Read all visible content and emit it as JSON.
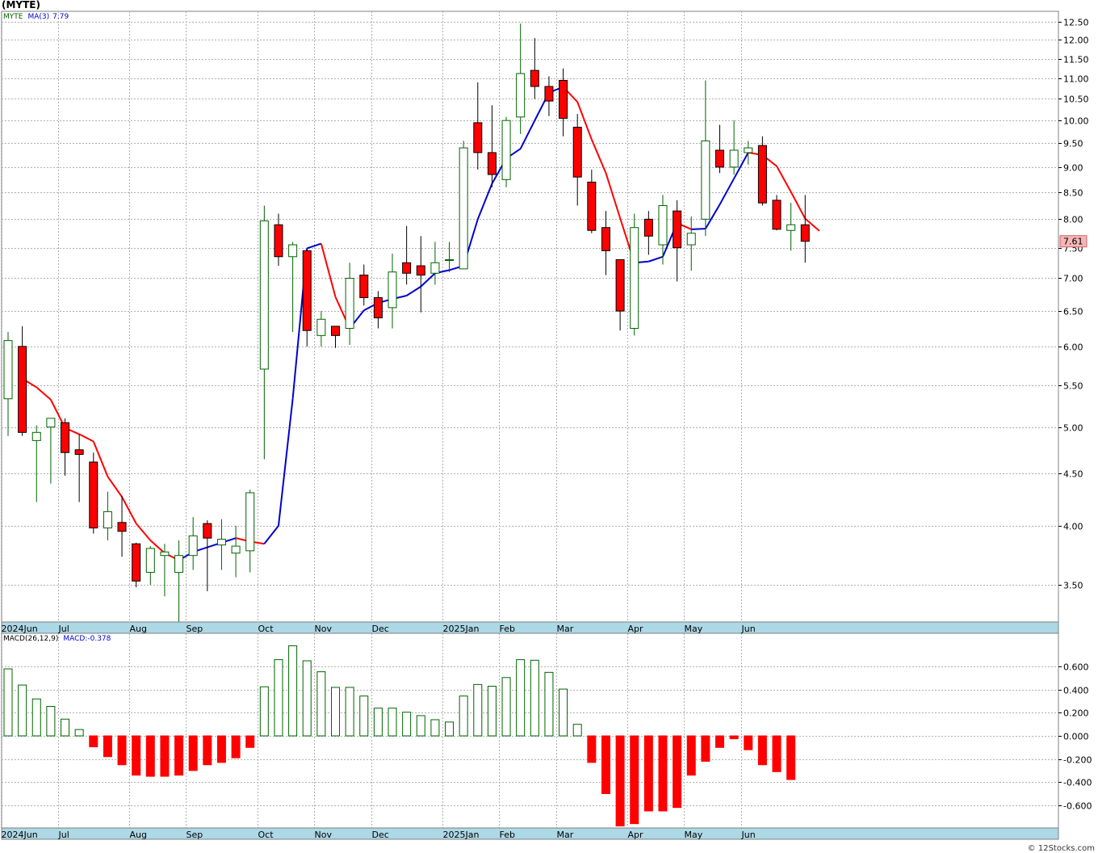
{
  "header": {
    "title": "(MYTE)"
  },
  "legend_price": {
    "symbol": "MYTE",
    "ma_label": "MA(3)",
    "ma_value": "7.79"
  },
  "legend_macd": {
    "label": "MACD(26,12,9)",
    "value": "MACD:-0.378"
  },
  "credit": "© 12Stocks.com",
  "colors": {
    "up": "#006400",
    "down": "#ff0000",
    "ma_up": "#0000cc",
    "ma_down": "#ff0000",
    "axis_band": "#add8e6",
    "grid": "#b0b0b0",
    "last_price_box": "#f4b6b6"
  },
  "chart_data": [
    {
      "type": "candlestick",
      "title": "(MYTE)",
      "scale": "log",
      "ylim": [
        3.2,
        12.8
      ],
      "y_ticks": [
        "12.50",
        "12.00",
        "11.50",
        "11.00",
        "10.50",
        "10.00",
        "9.50",
        "9.00",
        "8.50",
        "8.00",
        "7.50",
        "7.00",
        "6.50",
        "6.00",
        "5.50",
        "5.00",
        "4.50",
        "4.00",
        "3.50"
      ],
      "x_labels": [
        "2024Jun",
        "Jul",
        "Aug",
        "Sep",
        "Oct",
        "Nov",
        "Dec",
        "2025Jan",
        "Feb",
        "Mar",
        "Apr",
        "May",
        "Jun"
      ],
      "x_label_weeks": [
        0,
        4,
        9,
        13,
        18,
        22,
        26,
        31,
        35,
        39,
        44,
        48,
        52
      ],
      "last_price": "7.61",
      "candles": [
        {
          "o": 5.33,
          "h": 6.2,
          "l": 4.9,
          "c": 6.08
        },
        {
          "o": 6.0,
          "h": 6.28,
          "l": 4.9,
          "c": 4.94
        },
        {
          "o": 4.85,
          "h": 5.02,
          "l": 4.22,
          "c": 4.94
        },
        {
          "o": 5.0,
          "h": 5.1,
          "l": 4.4,
          "c": 5.1
        },
        {
          "o": 5.05,
          "h": 5.1,
          "l": 4.48,
          "c": 4.72
        },
        {
          "o": 4.75,
          "h": 4.92,
          "l": 4.22,
          "c": 4.7
        },
        {
          "o": 4.62,
          "h": 4.72,
          "l": 3.93,
          "c": 3.98
        },
        {
          "o": 3.98,
          "h": 4.32,
          "l": 3.87,
          "c": 4.13
        },
        {
          "o": 4.03,
          "h": 4.28,
          "l": 3.73,
          "c": 3.95
        },
        {
          "o": 3.84,
          "h": 3.85,
          "l": 3.48,
          "c": 3.53
        },
        {
          "o": 3.6,
          "h": 3.82,
          "l": 3.5,
          "c": 3.8
        },
        {
          "o": 3.74,
          "h": 3.84,
          "l": 3.41,
          "c": 3.77
        },
        {
          "o": 3.6,
          "h": 3.87,
          "l": 3.2,
          "c": 3.74
        },
        {
          "o": 3.74,
          "h": 4.08,
          "l": 3.62,
          "c": 3.91
        },
        {
          "o": 4.02,
          "h": 4.05,
          "l": 3.45,
          "c": 3.89
        },
        {
          "o": 3.83,
          "h": 4.06,
          "l": 3.62,
          "c": 3.88
        },
        {
          "o": 3.76,
          "h": 4.0,
          "l": 3.56,
          "c": 3.82
        },
        {
          "o": 3.78,
          "h": 4.34,
          "l": 3.6,
          "c": 4.31
        },
        {
          "o": 5.7,
          "h": 8.25,
          "l": 4.65,
          "c": 7.97
        },
        {
          "o": 7.9,
          "h": 8.1,
          "l": 7.2,
          "c": 7.35
        },
        {
          "o": 7.35,
          "h": 7.6,
          "l": 6.2,
          "c": 7.55
        },
        {
          "o": 7.45,
          "h": 7.45,
          "l": 6.0,
          "c": 6.22
        },
        {
          "o": 6.15,
          "h": 6.5,
          "l": 6.0,
          "c": 6.38
        },
        {
          "o": 6.28,
          "h": 6.28,
          "l": 5.98,
          "c": 6.15
        },
        {
          "o": 6.25,
          "h": 7.25,
          "l": 6.02,
          "c": 7.0
        },
        {
          "o": 7.05,
          "h": 7.22,
          "l": 6.58,
          "c": 6.7
        },
        {
          "o": 6.7,
          "h": 6.8,
          "l": 6.25,
          "c": 6.4
        },
        {
          "o": 6.55,
          "h": 7.4,
          "l": 6.25,
          "c": 7.1
        },
        {
          "o": 7.25,
          "h": 7.88,
          "l": 6.9,
          "c": 7.08
        },
        {
          "o": 7.2,
          "h": 7.7,
          "l": 6.48,
          "c": 7.05
        },
        {
          "o": 7.08,
          "h": 7.6,
          "l": 6.9,
          "c": 7.25
        },
        {
          "o": 7.3,
          "h": 7.6,
          "l": 7.1,
          "c": 7.3
        },
        {
          "o": 7.15,
          "h": 9.55,
          "l": 7.15,
          "c": 9.4
        },
        {
          "o": 9.95,
          "h": 10.9,
          "l": 8.95,
          "c": 9.3
        },
        {
          "o": 9.3,
          "h": 10.35,
          "l": 8.6,
          "c": 8.85
        },
        {
          "o": 8.75,
          "h": 10.08,
          "l": 8.6,
          "c": 10.0
        },
        {
          "o": 10.08,
          "h": 12.45,
          "l": 9.7,
          "c": 11.12
        },
        {
          "o": 11.2,
          "h": 12.05,
          "l": 10.5,
          "c": 10.8
        },
        {
          "o": 10.8,
          "h": 11.05,
          "l": 10.1,
          "c": 10.45
        },
        {
          "o": 10.95,
          "h": 11.25,
          "l": 9.65,
          "c": 10.05
        },
        {
          "o": 9.85,
          "h": 10.15,
          "l": 8.25,
          "c": 8.8
        },
        {
          "o": 8.7,
          "h": 8.95,
          "l": 7.75,
          "c": 7.8
        },
        {
          "o": 7.85,
          "h": 8.15,
          "l": 7.05,
          "c": 7.45
        },
        {
          "o": 7.3,
          "h": 7.3,
          "l": 6.22,
          "c": 6.5
        },
        {
          "o": 6.25,
          "h": 8.1,
          "l": 6.15,
          "c": 7.85
        },
        {
          "o": 8.0,
          "h": 8.15,
          "l": 7.38,
          "c": 7.7
        },
        {
          "o": 7.55,
          "h": 8.45,
          "l": 7.22,
          "c": 8.25
        },
        {
          "o": 8.15,
          "h": 8.35,
          "l": 6.95,
          "c": 7.5
        },
        {
          "o": 7.55,
          "h": 8.05,
          "l": 7.12,
          "c": 7.75
        },
        {
          "o": 8.0,
          "h": 10.95,
          "l": 7.7,
          "c": 9.55
        },
        {
          "o": 9.35,
          "h": 9.9,
          "l": 8.88,
          "c": 9.0
        },
        {
          "o": 9.0,
          "h": 10.0,
          "l": 8.85,
          "c": 9.35
        },
        {
          "o": 9.3,
          "h": 9.55,
          "l": 9.05,
          "c": 9.4
        },
        {
          "o": 9.45,
          "h": 9.65,
          "l": 8.25,
          "c": 8.3
        },
        {
          "o": 8.35,
          "h": 8.45,
          "l": 7.8,
          "c": 7.82
        },
        {
          "o": 7.8,
          "h": 8.3,
          "l": 7.45,
          "c": 7.9
        },
        {
          "o": 7.9,
          "h": 8.45,
          "l": 7.25,
          "c": 7.61
        }
      ],
      "series": [
        {
          "name": "MA(3)",
          "values": [
            5.58,
            5.47,
            5.32,
            4.99,
            4.92,
            4.84,
            4.47,
            4.27,
            4.02,
            3.87,
            3.76,
            3.7,
            3.77,
            3.81,
            3.85,
            3.89,
            3.86,
            3.84,
            4.0,
            5.33,
            7.49,
            7.57,
            6.71,
            6.25,
            6.51,
            6.62,
            6.68,
            6.73,
            6.87,
            7.08,
            7.13,
            7.2,
            8.0,
            8.67,
            9.18,
            9.38,
            10.0,
            10.65,
            10.79,
            10.43,
            9.58,
            8.88,
            8.02,
            7.25,
            7.27,
            7.35,
            7.93,
            7.82,
            7.83,
            8.27,
            8.77,
            9.3,
            9.25,
            9.02,
            8.51,
            8.01,
            7.79
          ]
        }
      ]
    },
    {
      "type": "bar",
      "title": "MACD(26,12,9)",
      "ylim": [
        -0.78,
        0.78
      ],
      "y_ticks": [
        "0.600",
        "0.400",
        "0.200",
        "0.000",
        "-0.200",
        "-0.400",
        "-0.600"
      ],
      "series": [
        {
          "name": "MACD",
          "values": [
            0.58,
            0.44,
            0.32,
            0.255,
            0.145,
            0.055,
            -0.095,
            -0.18,
            -0.25,
            -0.34,
            -0.35,
            -0.35,
            -0.34,
            -0.3,
            -0.25,
            -0.23,
            -0.19,
            -0.1,
            0.425,
            0.66,
            0.78,
            0.65,
            0.555,
            0.42,
            0.42,
            0.345,
            0.24,
            0.24,
            0.205,
            0.175,
            0.14,
            0.12,
            0.345,
            0.445,
            0.43,
            0.505,
            0.66,
            0.655,
            0.55,
            0.405,
            0.1,
            -0.23,
            -0.5,
            -0.78,
            -0.76,
            -0.65,
            -0.65,
            -0.62,
            -0.34,
            -0.22,
            -0.1,
            -0.025,
            -0.12,
            -0.25,
            -0.31,
            -0.378
          ]
        }
      ]
    }
  ]
}
